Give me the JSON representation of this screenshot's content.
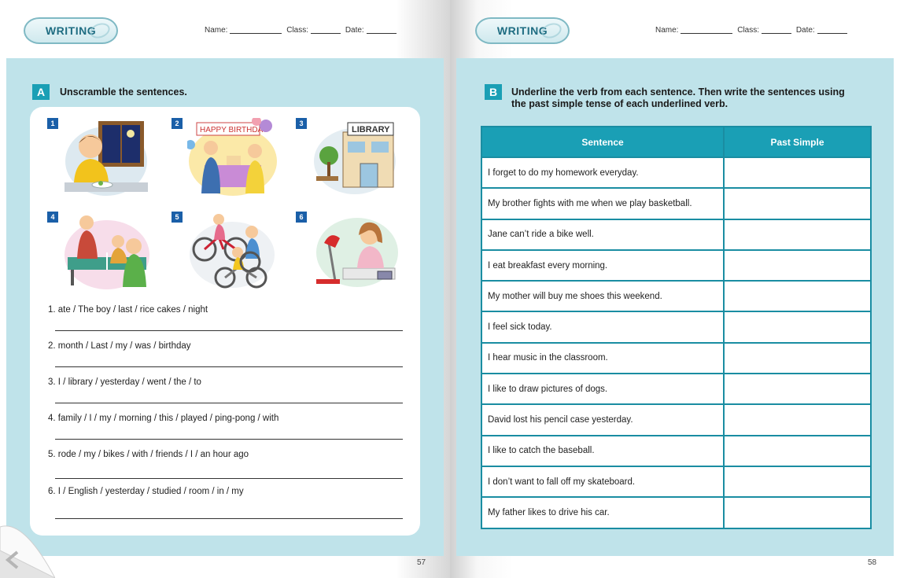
{
  "left_page": {
    "header": {
      "badge": "WRITING",
      "name_label": "Name:",
      "class_label": "Class:",
      "date_label": "Date:"
    },
    "section": {
      "letter": "A",
      "title": "Unscramble the sentences."
    },
    "pictures": [
      {
        "num": "1",
        "icon": "boy-eating-at-night-icon"
      },
      {
        "num": "2",
        "icon": "birthday-party-icon"
      },
      {
        "num": "3",
        "icon": "library-building-icon",
        "sign": "LIBRARY"
      },
      {
        "num": "4",
        "icon": "ping-pong-family-icon"
      },
      {
        "num": "5",
        "icon": "riding-bikes-icon"
      },
      {
        "num": "6",
        "icon": "girl-studying-icon"
      }
    ],
    "birthday_banner": "HAPPY BIRTHDAY",
    "questions": [
      "1. ate / The boy / last / rice cakes / night",
      "2. month / Last / my / was / birthday",
      "3. I / library / yesterday / went / the / to",
      "4. family / I / my / morning / this / played / ping-pong / with",
      "5. rode / my / bikes / with / friends / I / an hour ago",
      "6. I / English / yesterday / studied / room / in / my"
    ],
    "page_number": "57"
  },
  "right_page": {
    "header": {
      "badge": "WRITING",
      "name_label": "Name:",
      "class_label": "Class:",
      "date_label": "Date:"
    },
    "section": {
      "letter": "B",
      "title_line1": "Underline the verb from each sentence. Then write the sentences using",
      "title_line2": "the past simple tense of each underlined verb."
    },
    "table": {
      "headers": [
        "Sentence",
        "Past Simple"
      ],
      "rows": [
        "I forget to do my homework everyday.",
        "My brother fights with me when we play basketball.",
        "Jane can’t ride a bike well.",
        "I eat breakfast every morning.",
        "My mother will buy me shoes this weekend.",
        "I feel sick today.",
        "I hear music in the classroom.",
        "I like to draw pictures of dogs.",
        "David lost his pencil case yesterday.",
        "I like to catch the baseball.",
        "I don’t want to fall off my skateboard.",
        "My father likes to drive his car."
      ]
    },
    "page_number": "58"
  },
  "colors": {
    "panel": "#bfe3ea",
    "accent": "#1a9fb5",
    "number_box": "#1a5fa8"
  }
}
